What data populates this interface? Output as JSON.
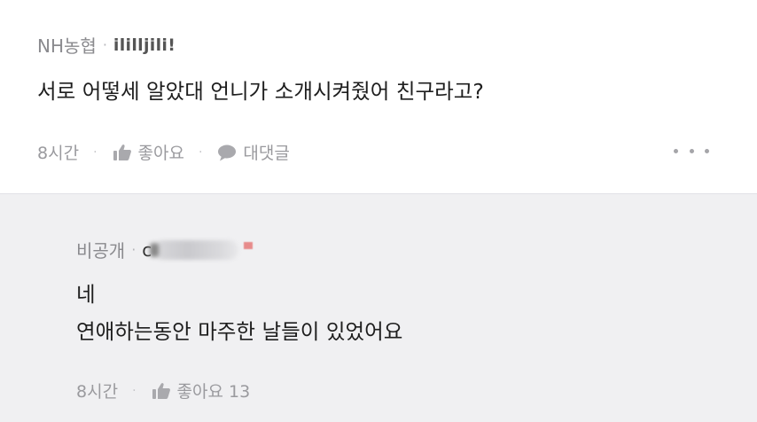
{
  "comment": {
    "nickname": "NH농협",
    "separator": "·",
    "handle": "ililljili!",
    "text": "서로 어떻세 알았대 언니가 소개시켜줬어 친구라고?",
    "time": "8시간",
    "like_label": "좋아요",
    "reply_label": "대댓글",
    "dot": "·"
  },
  "reply": {
    "nickname": "비공개",
    "separator": "·",
    "handle_prefix": "c",
    "text_line1": "네",
    "text_line2": "연애하는동안 마주한 날들이 있었어요",
    "time": "8시간",
    "like_label": "좋아요 13",
    "dot": "·"
  },
  "icons": {
    "like": "thumbs-up-icon",
    "reply": "speech-bubble-icon",
    "more": "more-dots-icon"
  },
  "colors": {
    "reply_background": "#f0f0f2",
    "secondary_text": "#9a9a9e"
  }
}
